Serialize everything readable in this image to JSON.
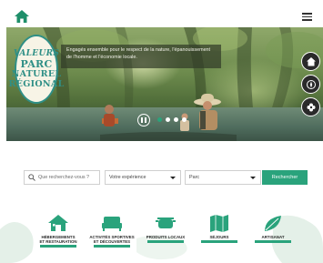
{
  "header": {
    "home_icon": "home-icon",
    "menu_icon": "hamburger-menu-icon"
  },
  "hero": {
    "caption": "Engagés ensemble pour le respect de la nature, l'épanouissement de l'homme et l'économie locale.",
    "badge": {
      "line1": "VALEURS",
      "line2": "PARC",
      "line3": "NATUREL",
      "line4": "RÉGIONAL"
    },
    "slides_count": 4,
    "active_slide": 1,
    "side_icons": [
      "house-marker-icon",
      "compass-icon",
      "flower-icon"
    ]
  },
  "search": {
    "placeholder": "Que recherchez-vous ?",
    "experience_label": "Votre expérience",
    "parc_label": "Parc",
    "button_label": "Rechercher"
  },
  "categories": [
    {
      "label_line1": "HÉBERGEMENTS",
      "label_line2": "ET RESTAURATION",
      "icon": "house-icon"
    },
    {
      "label_line1": "ACTIVITÉS SPORTIVES",
      "label_line2": "ET DÉCOUVERTES",
      "icon": "bed-icon"
    },
    {
      "label_line1": "PRODUITS LOCAUX",
      "label_line2": "",
      "icon": "cooking-pot-icon"
    },
    {
      "label_line1": "SÉJOURS",
      "label_line2": "",
      "icon": "map-icon"
    },
    {
      "label_line1": "ARTISANAT",
      "label_line2": "",
      "icon": "leaf-icon"
    }
  ],
  "colors": {
    "accent": "#2aa37c",
    "badge_teal": "#2f8f86",
    "dark": "#2a2a2a"
  }
}
